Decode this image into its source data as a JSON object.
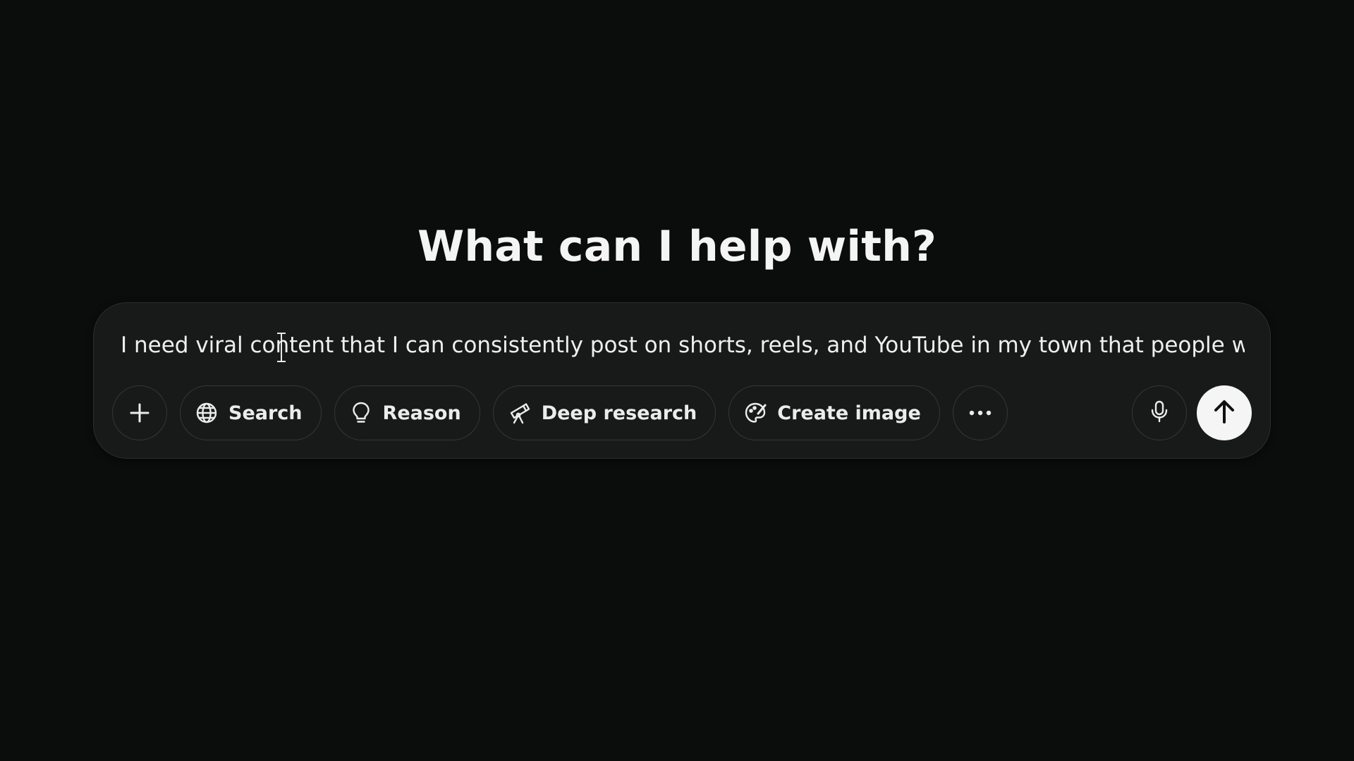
{
  "page": {
    "headline": "What can I help with?"
  },
  "composer": {
    "text": "I need viral content that I can consistently post on shorts, reels, and YouTube in my town that people w"
  },
  "toolbar": {
    "add_icon": "plus-icon",
    "buttons": [
      {
        "label": "Search",
        "icon": "globe-icon"
      },
      {
        "label": "Reason",
        "icon": "lightbulb-icon"
      },
      {
        "label": "Deep research",
        "icon": "telescope-icon"
      },
      {
        "label": "Create image",
        "icon": "palette-icon"
      }
    ],
    "more_icon": "more-dots-icon",
    "mic_icon": "microphone-icon",
    "send_icon": "arrow-up-icon"
  },
  "colors": {
    "background": "#0b0c0c",
    "composer": "#181a19",
    "border": "#363837",
    "text": "#ececec",
    "send_button": "#f5f5f5"
  }
}
